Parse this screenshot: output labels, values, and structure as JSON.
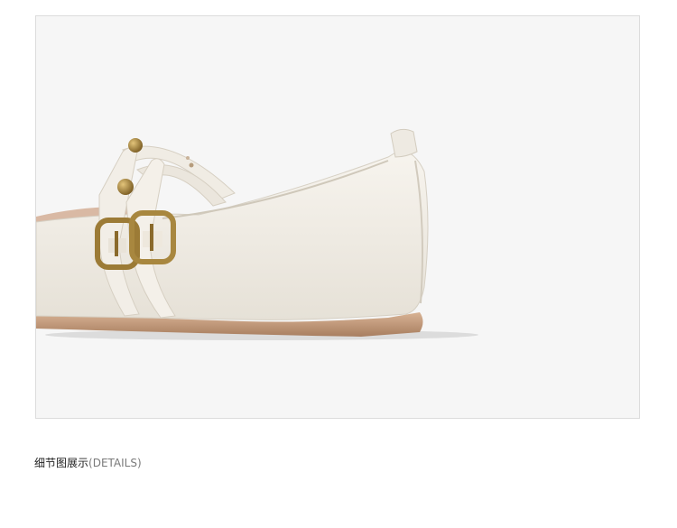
{
  "product_photo": {
    "subject": "cream-flat-shoe-detail",
    "background_color": "#f6f6f6",
    "leather_color": "#efebe3",
    "hardware_color": "#a8873f",
    "sole_color": "#c9a081"
  },
  "caption": {
    "chinese_label": "细节图展示",
    "english_label": "(DETAILS)"
  }
}
